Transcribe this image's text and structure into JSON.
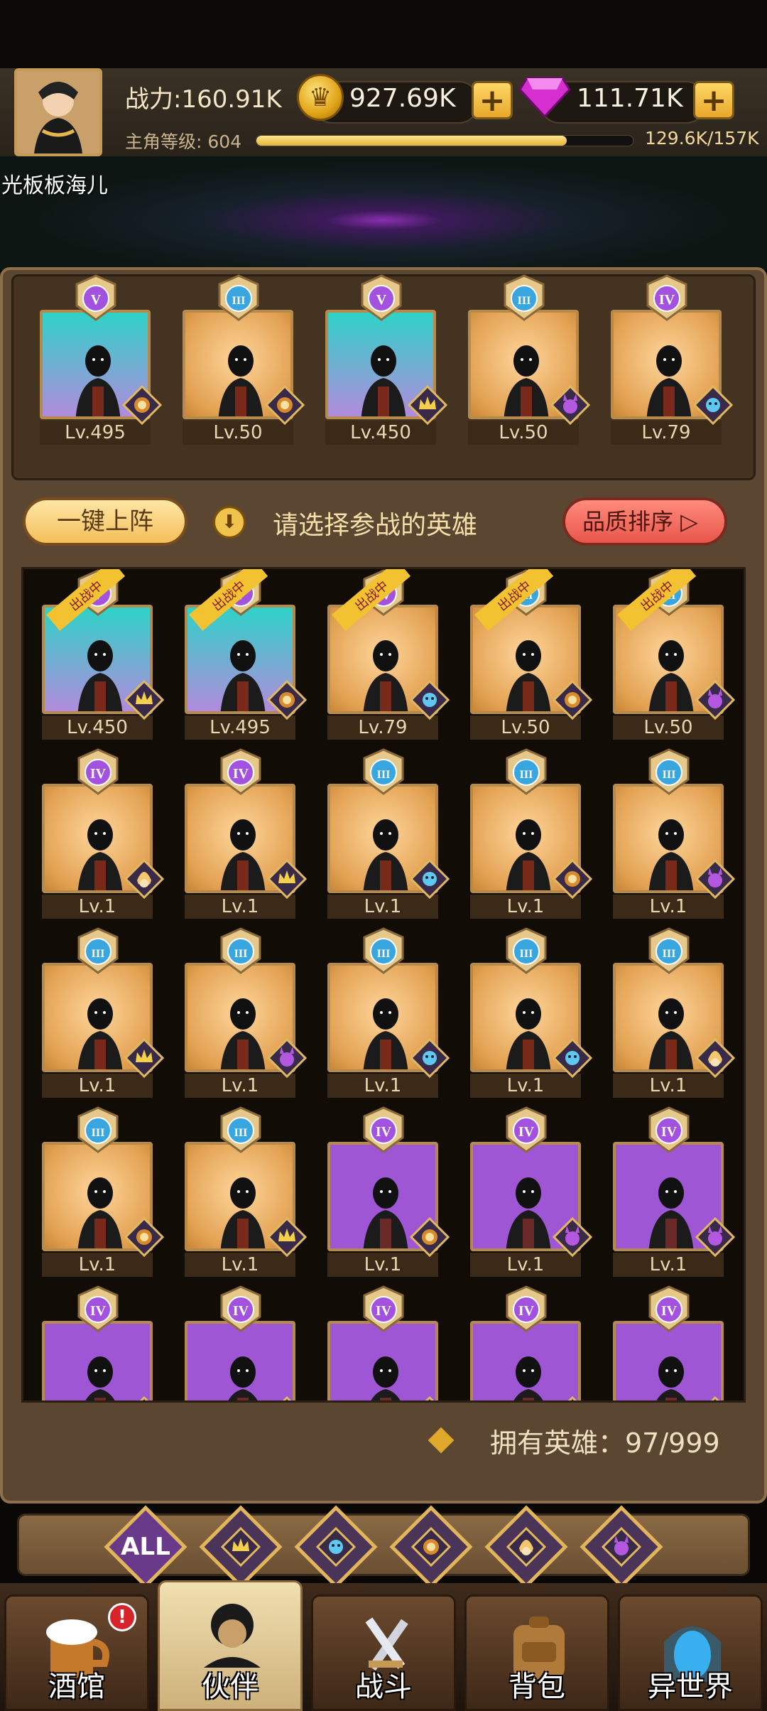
{
  "header": {
    "power_label": "战力:160.91K",
    "gold": "927.69K",
    "gems": "111.71K",
    "level_label": "主角等级:",
    "level": "604",
    "xp_text": "129.6K/157K",
    "xp_fraction": 0.825,
    "username": "光板板海儿"
  },
  "team": [
    {
      "level": "Lv.495",
      "rank": "V",
      "bg": "teal",
      "faction": "lion-icon"
    },
    {
      "level": "Lv.50",
      "rank": "III",
      "bg": "gold",
      "faction": "lion-icon"
    },
    {
      "level": "Lv.450",
      "rank": "V",
      "bg": "teal",
      "faction": "crown-icon"
    },
    {
      "level": "Lv.50",
      "rank": "III",
      "bg": "gold",
      "faction": "demon-icon"
    },
    {
      "level": "Lv.79",
      "rank": "IV",
      "bg": "gold",
      "faction": "fish-icon"
    }
  ],
  "controls": {
    "one_key": "一键上阵",
    "tip": "请选择参战的英雄",
    "sort": "品质排序"
  },
  "deployed_label": "出战中",
  "heroes": [
    {
      "level": "Lv.450",
      "rank": "V",
      "bg": "teal",
      "faction": "crown-icon",
      "deployed": true
    },
    {
      "level": "Lv.495",
      "rank": "V",
      "bg": "teal",
      "faction": "lion-icon",
      "deployed": true
    },
    {
      "level": "Lv.79",
      "rank": "IV",
      "bg": "gold",
      "faction": "fish-icon",
      "deployed": true
    },
    {
      "level": "Lv.50",
      "rank": "III",
      "bg": "gold",
      "faction": "lion-icon",
      "deployed": true
    },
    {
      "level": "Lv.50",
      "rank": "III",
      "bg": "gold",
      "faction": "demon-icon",
      "deployed": true
    },
    {
      "level": "Lv.1",
      "rank": "IV",
      "bg": "gold",
      "faction": "elf-icon",
      "deployed": false
    },
    {
      "level": "Lv.1",
      "rank": "IV",
      "bg": "gold",
      "faction": "crown-icon",
      "deployed": false
    },
    {
      "level": "Lv.1",
      "rank": "III",
      "bg": "gold",
      "faction": "fish-icon",
      "deployed": false
    },
    {
      "level": "Lv.1",
      "rank": "III",
      "bg": "gold",
      "faction": "lion-icon",
      "deployed": false
    },
    {
      "level": "Lv.1",
      "rank": "III",
      "bg": "gold",
      "faction": "demon-icon",
      "deployed": false
    },
    {
      "level": "Lv.1",
      "rank": "III",
      "bg": "gold",
      "faction": "crown-icon",
      "deployed": false
    },
    {
      "level": "Lv.1",
      "rank": "III",
      "bg": "gold",
      "faction": "demon-icon",
      "deployed": false
    },
    {
      "level": "Lv.1",
      "rank": "III",
      "bg": "gold",
      "faction": "fish-icon",
      "deployed": false
    },
    {
      "level": "Lv.1",
      "rank": "III",
      "bg": "gold",
      "faction": "fish-icon",
      "deployed": false
    },
    {
      "level": "Lv.1",
      "rank": "III",
      "bg": "gold",
      "faction": "elf-icon",
      "deployed": false
    },
    {
      "level": "Lv.1",
      "rank": "III",
      "bg": "gold",
      "faction": "lion-icon",
      "deployed": false
    },
    {
      "level": "Lv.1",
      "rank": "III",
      "bg": "gold",
      "faction": "crown-icon",
      "deployed": false
    },
    {
      "level": "Lv.1",
      "rank": "IV",
      "bg": "purple",
      "faction": "lion-icon",
      "deployed": false
    },
    {
      "level": "Lv.1",
      "rank": "IV",
      "bg": "purple",
      "faction": "demon-icon",
      "deployed": false
    },
    {
      "level": "Lv.1",
      "rank": "IV",
      "bg": "purple",
      "faction": "demon-icon",
      "deployed": false
    },
    {
      "level": "",
      "rank": "IV",
      "bg": "purple",
      "faction": "elf-icon",
      "deployed": false
    },
    {
      "level": "",
      "rank": "IV",
      "bg": "purple",
      "faction": "elf-icon",
      "deployed": false
    },
    {
      "level": "",
      "rank": "IV",
      "bg": "purple",
      "faction": "crown-icon",
      "deployed": false
    },
    {
      "level": "",
      "rank": "IV",
      "bg": "purple",
      "faction": "fish-icon",
      "deployed": false
    },
    {
      "level": "",
      "rank": "IV",
      "bg": "purple",
      "faction": "demon-icon",
      "deployed": false
    }
  ],
  "owned": "拥有英雄：97/999",
  "filters": [
    {
      "label": "ALL",
      "icon": "all-filter-icon"
    },
    {
      "label": "",
      "icon": "crown-icon"
    },
    {
      "label": "",
      "icon": "fish-icon"
    },
    {
      "label": "",
      "icon": "lion-icon"
    },
    {
      "label": "",
      "icon": "elf-icon"
    },
    {
      "label": "",
      "icon": "demon-icon"
    }
  ],
  "nav": [
    {
      "label": "酒馆",
      "icon": "beer-mug-icon",
      "alert": "!"
    },
    {
      "label": "伙伴",
      "icon": "partner-icon",
      "active": true
    },
    {
      "label": "战斗",
      "icon": "crossed-swords-icon"
    },
    {
      "label": "背包",
      "icon": "backpack-icon"
    },
    {
      "label": "异世界",
      "icon": "portal-icon"
    }
  ],
  "colors": {
    "gold": "#f0c34c",
    "panel": "#5b4632",
    "teal": "#2fd2c8",
    "purple": "#9f56d4",
    "sort": "#e8564b"
  }
}
